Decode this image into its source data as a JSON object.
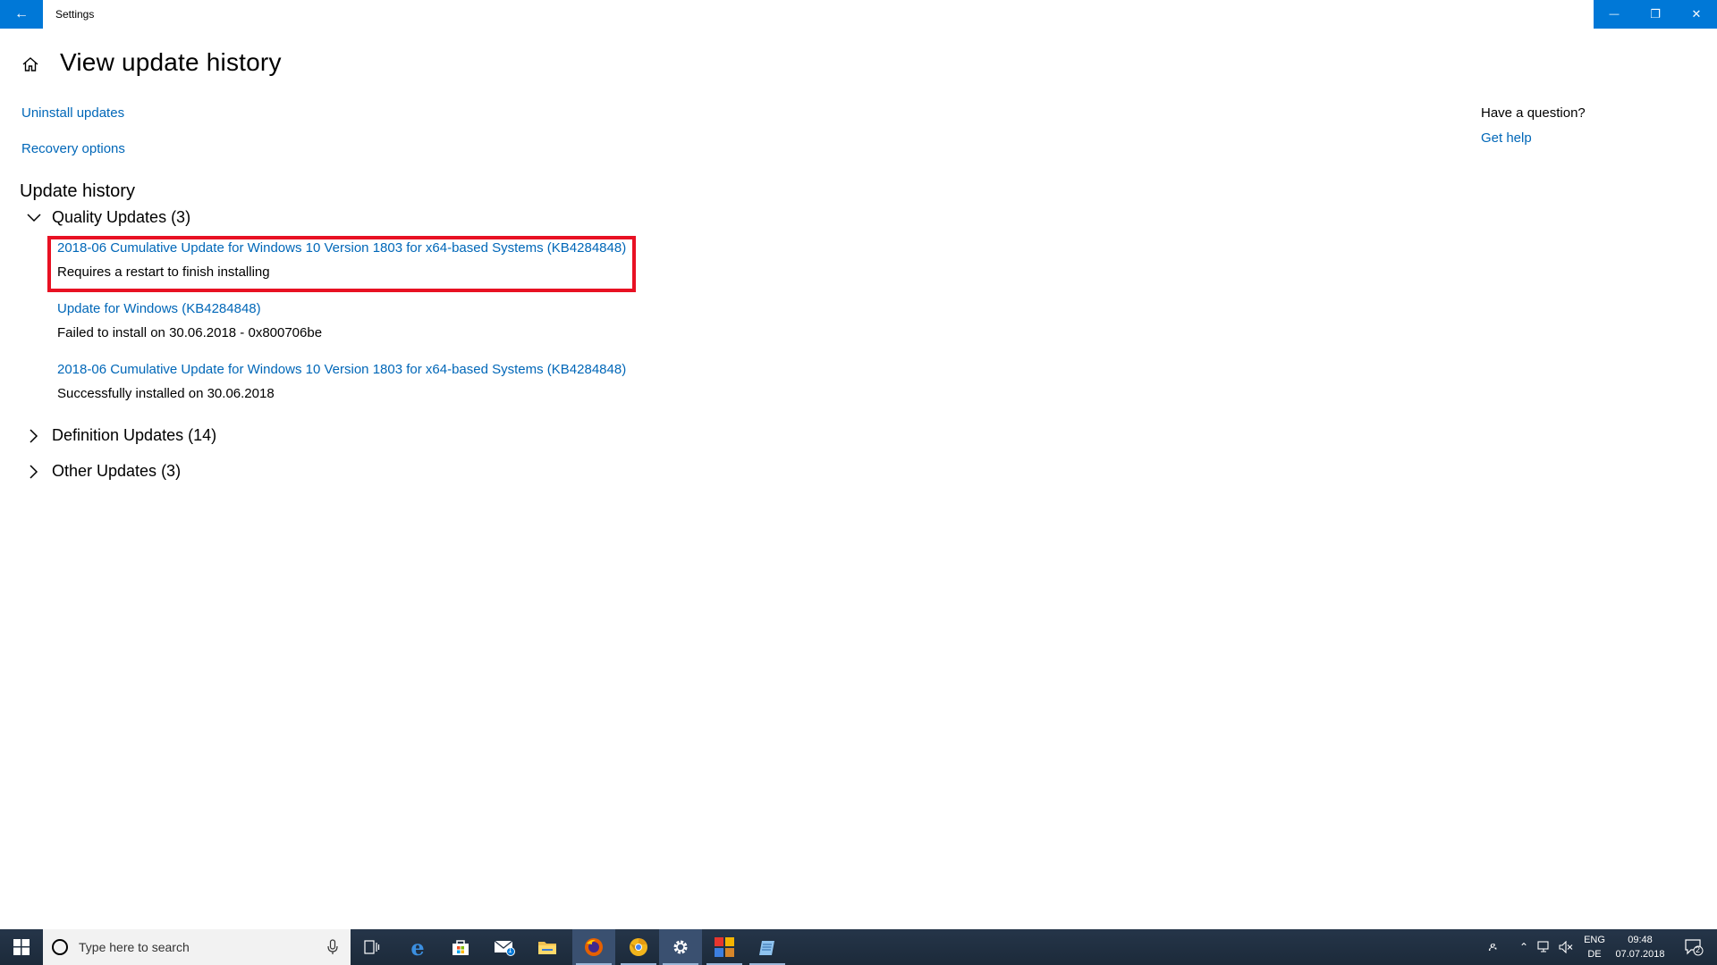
{
  "window": {
    "title": "Settings",
    "back_glyph": "←",
    "minimize_glyph": "—",
    "restore_glyph": "❐",
    "close_glyph": "✕"
  },
  "page": {
    "title": "View update history",
    "links": {
      "uninstall": "Uninstall updates",
      "recovery": "Recovery options"
    },
    "section_title": "Update history",
    "groups": [
      {
        "label": "Quality Updates (3)",
        "expanded": true,
        "items": [
          {
            "name": "2018-06 Cumulative Update for Windows 10 Version 1803 for x64-based Systems (KB4284848)",
            "status": "Requires a restart to finish installing",
            "highlighted": true
          },
          {
            "name": "Update for Windows (KB4284848)",
            "status": "Failed to install on 30.06.2018 - 0x800706be"
          },
          {
            "name": "2018-06 Cumulative Update for Windows 10 Version 1803 for x64-based Systems (KB4284848)",
            "status": "Successfully installed on 30.06.2018"
          }
        ]
      },
      {
        "label": "Definition Updates (14)",
        "expanded": false
      },
      {
        "label": "Other Updates (3)",
        "expanded": false
      }
    ],
    "highlight_color": "#e81123",
    "link_color": "#0067b8"
  },
  "help": {
    "title": "Have a question?",
    "link": "Get help"
  },
  "taskbar": {
    "search_placeholder": "Type here to search",
    "apps": [
      "task-view-icon",
      "edge-icon",
      "store-icon",
      "mail-icon",
      "file-explorer-icon",
      "firefox-icon",
      "chrome-canary-icon",
      "settings-icon",
      "office-icon",
      "notepad-icon"
    ],
    "mail_badge": "1",
    "language": "ENG",
    "keyboard_layout": "DE",
    "time": "09:48",
    "date": "07.07.2018",
    "notification_count": "2",
    "accent": "#0078d7"
  }
}
